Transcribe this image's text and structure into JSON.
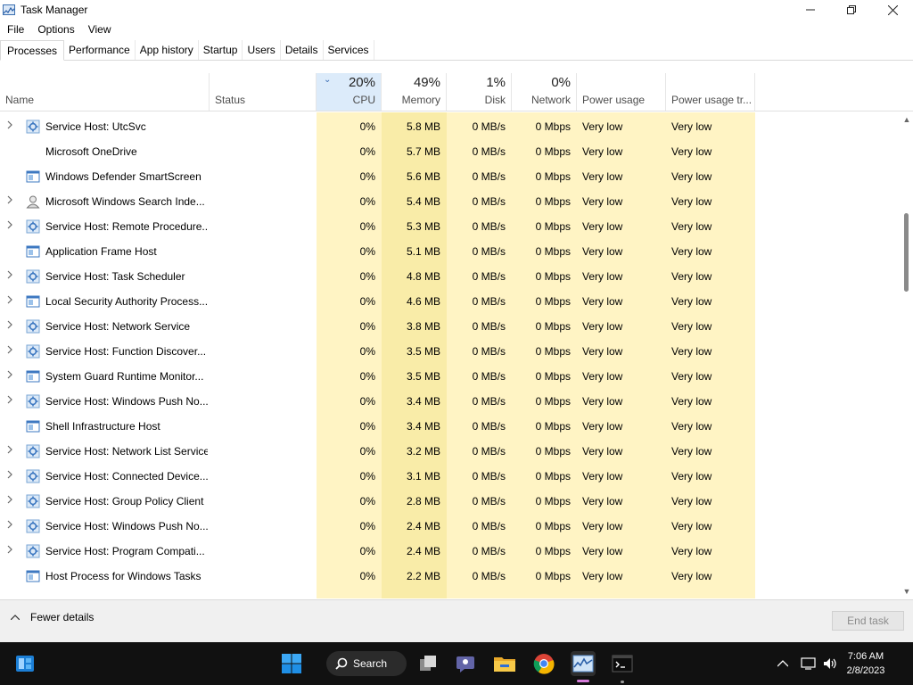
{
  "window": {
    "title": "Task Manager",
    "controls": {
      "minimize": "—",
      "maximize": "❐",
      "close": "✕"
    }
  },
  "menu": [
    "File",
    "Options",
    "View"
  ],
  "tabs": [
    "Processes",
    "Performance",
    "App history",
    "Startup",
    "Users",
    "Details",
    "Services"
  ],
  "active_tab": "Processes",
  "columns": {
    "name": {
      "label": "Name"
    },
    "status": {
      "label": "Status"
    },
    "cpu": {
      "pct": "20%",
      "label": "CPU"
    },
    "memory": {
      "pct": "49%",
      "label": "Memory"
    },
    "disk": {
      "pct": "1%",
      "label": "Disk"
    },
    "network": {
      "pct": "0%",
      "label": "Network"
    },
    "power": {
      "label": "Power usage"
    },
    "power_trend": {
      "label": "Power usage tr..."
    }
  },
  "processes": [
    {
      "name": "Service Host: UtcSvc",
      "expandable": true,
      "icon": "gear",
      "cpu": "0%",
      "memory": "5.8 MB",
      "disk": "0 MB/s",
      "network": "0 Mbps",
      "power": "Very low",
      "power_trend": "Very low"
    },
    {
      "name": "Microsoft OneDrive",
      "expandable": false,
      "icon": "none",
      "cpu": "0%",
      "memory": "5.7 MB",
      "disk": "0 MB/s",
      "network": "0 Mbps",
      "power": "Very low",
      "power_trend": "Very low"
    },
    {
      "name": "Windows Defender SmartScreen",
      "expandable": false,
      "icon": "window",
      "cpu": "0%",
      "memory": "5.6 MB",
      "disk": "0 MB/s",
      "network": "0 Mbps",
      "power": "Very low",
      "power_trend": "Very low"
    },
    {
      "name": "Microsoft Windows Search Inde...",
      "expandable": true,
      "icon": "person",
      "cpu": "0%",
      "memory": "5.4 MB",
      "disk": "0 MB/s",
      "network": "0 Mbps",
      "power": "Very low",
      "power_trend": "Very low"
    },
    {
      "name": "Service Host: Remote Procedure...",
      "expandable": true,
      "icon": "gear",
      "cpu": "0%",
      "memory": "5.3 MB",
      "disk": "0 MB/s",
      "network": "0 Mbps",
      "power": "Very low",
      "power_trend": "Very low"
    },
    {
      "name": "Application Frame Host",
      "expandable": false,
      "icon": "window",
      "cpu": "0%",
      "memory": "5.1 MB",
      "disk": "0 MB/s",
      "network": "0 Mbps",
      "power": "Very low",
      "power_trend": "Very low"
    },
    {
      "name": "Service Host: Task Scheduler",
      "expandable": true,
      "icon": "gear",
      "cpu": "0%",
      "memory": "4.8 MB",
      "disk": "0 MB/s",
      "network": "0 Mbps",
      "power": "Very low",
      "power_trend": "Very low"
    },
    {
      "name": "Local Security Authority Process...",
      "expandable": true,
      "icon": "window",
      "cpu": "0%",
      "memory": "4.6 MB",
      "disk": "0 MB/s",
      "network": "0 Mbps",
      "power": "Very low",
      "power_trend": "Very low"
    },
    {
      "name": "Service Host: Network Service",
      "expandable": true,
      "icon": "gear",
      "cpu": "0%",
      "memory": "3.8 MB",
      "disk": "0 MB/s",
      "network": "0 Mbps",
      "power": "Very low",
      "power_trend": "Very low"
    },
    {
      "name": "Service Host: Function Discover...",
      "expandable": true,
      "icon": "gear",
      "cpu": "0%",
      "memory": "3.5 MB",
      "disk": "0 MB/s",
      "network": "0 Mbps",
      "power": "Very low",
      "power_trend": "Very low"
    },
    {
      "name": "System Guard Runtime Monitor...",
      "expandable": true,
      "icon": "window",
      "cpu": "0%",
      "memory": "3.5 MB",
      "disk": "0 MB/s",
      "network": "0 Mbps",
      "power": "Very low",
      "power_trend": "Very low"
    },
    {
      "name": "Service Host: Windows Push No...",
      "expandable": true,
      "icon": "gear",
      "cpu": "0%",
      "memory": "3.4 MB",
      "disk": "0 MB/s",
      "network": "0 Mbps",
      "power": "Very low",
      "power_trend": "Very low"
    },
    {
      "name": "Shell Infrastructure Host",
      "expandable": false,
      "icon": "window",
      "cpu": "0%",
      "memory": "3.4 MB",
      "disk": "0 MB/s",
      "network": "0 Mbps",
      "power": "Very low",
      "power_trend": "Very low"
    },
    {
      "name": "Service Host: Network List Service",
      "expandable": true,
      "icon": "gear",
      "cpu": "0%",
      "memory": "3.2 MB",
      "disk": "0 MB/s",
      "network": "0 Mbps",
      "power": "Very low",
      "power_trend": "Very low"
    },
    {
      "name": "Service Host: Connected Device...",
      "expandable": true,
      "icon": "gear",
      "cpu": "0%",
      "memory": "3.1 MB",
      "disk": "0 MB/s",
      "network": "0 Mbps",
      "power": "Very low",
      "power_trend": "Very low"
    },
    {
      "name": "Service Host: Group Policy Client",
      "expandable": true,
      "icon": "gear",
      "cpu": "0%",
      "memory": "2.8 MB",
      "disk": "0 MB/s",
      "network": "0 Mbps",
      "power": "Very low",
      "power_trend": "Very low"
    },
    {
      "name": "Service Host: Windows Push No...",
      "expandable": true,
      "icon": "gear",
      "cpu": "0%",
      "memory": "2.4 MB",
      "disk": "0 MB/s",
      "network": "0 Mbps",
      "power": "Very low",
      "power_trend": "Very low"
    },
    {
      "name": "Service Host: Program Compati...",
      "expandable": true,
      "icon": "gear",
      "cpu": "0%",
      "memory": "2.4 MB",
      "disk": "0 MB/s",
      "network": "0 Mbps",
      "power": "Very low",
      "power_trend": "Very low"
    },
    {
      "name": "Host Process for Windows Tasks",
      "expandable": false,
      "icon": "window",
      "cpu": "0%",
      "memory": "2.2 MB",
      "disk": "0 MB/s",
      "network": "0 Mbps",
      "power": "Very low",
      "power_trend": "Very low"
    }
  ],
  "footer": {
    "fewer_details": "Fewer details",
    "end_task": "End task"
  },
  "taskbar": {
    "search_label": "Search",
    "time": "7:06 AM",
    "date": "2/8/2023",
    "pinned_icons": [
      "start-icon",
      "task-view-icon",
      "teams-chat-icon",
      "file-explorer-icon",
      "chrome-icon",
      "task-manager-icon",
      "terminal-icon"
    ]
  },
  "colors": {
    "heat_light": "#fff4c4",
    "heat_mid": "#f9eca8",
    "sorted_header": "#dcebfa",
    "accent": "#0078d4"
  }
}
